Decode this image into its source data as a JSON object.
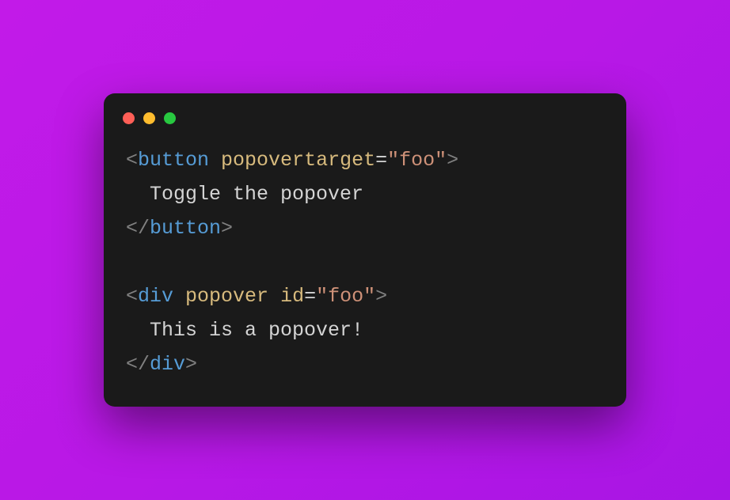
{
  "window": {
    "buttons": {
      "close": "close",
      "minimize": "minimize",
      "maximize": "maximize"
    }
  },
  "code": {
    "line1": {
      "open": "<",
      "tag": "button",
      "space": " ",
      "attr": "popovertarget",
      "eq": "=",
      "value": "\"foo\"",
      "close": ">"
    },
    "line2": {
      "indent": "  ",
      "text": "Toggle the popover"
    },
    "line3": {
      "open": "</",
      "tag": "button",
      "close": ">"
    },
    "line5": {
      "open": "<",
      "tag": "div",
      "space1": " ",
      "attr1": "popover",
      "space2": " ",
      "attr2": "id",
      "eq": "=",
      "value": "\"foo\"",
      "close": ">"
    },
    "line6": {
      "indent": "  ",
      "text": "This is a popover!"
    },
    "line7": {
      "open": "</",
      "tag": "div",
      "close": ">"
    }
  }
}
